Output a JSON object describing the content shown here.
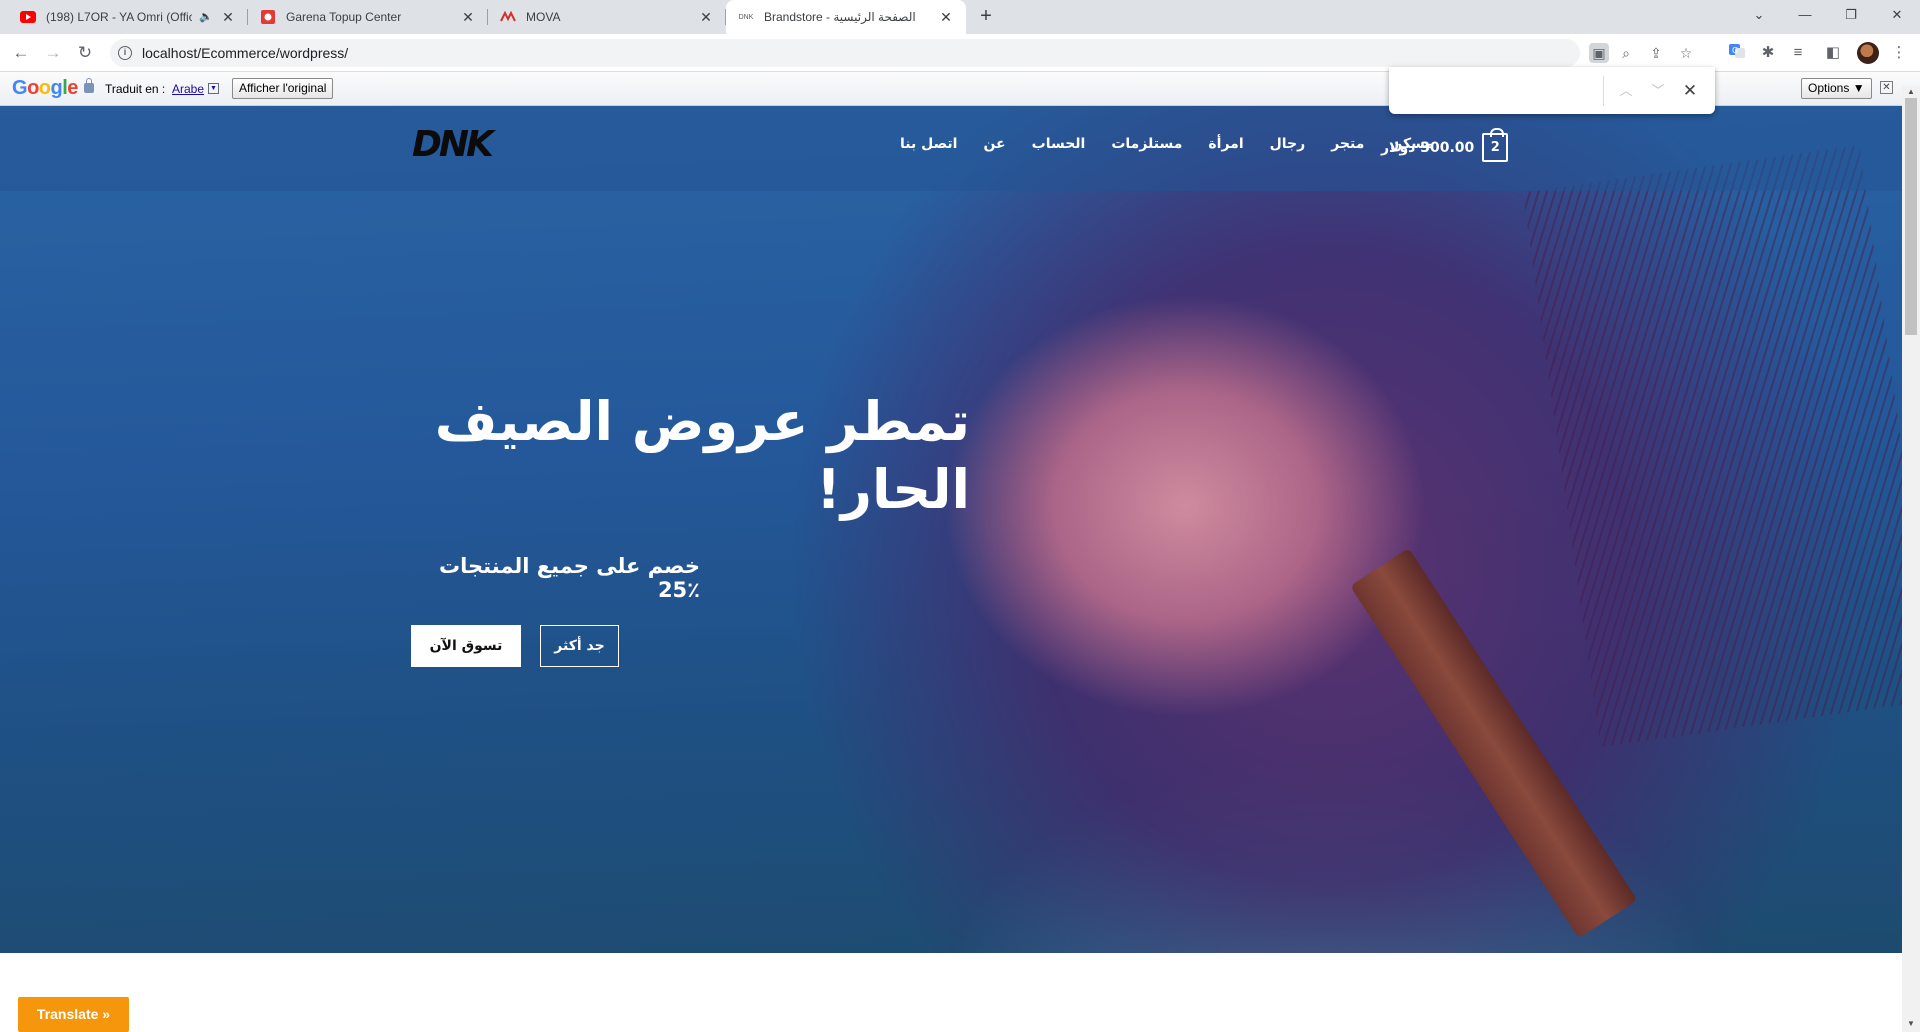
{
  "browser": {
    "tabs": [
      {
        "title": "(198) L7OR - YA Omri (Officia",
        "favicon": "youtube-icon",
        "audio": true
      },
      {
        "title": "Garena Topup Center",
        "favicon": "garena-icon"
      },
      {
        "title": "MOVA",
        "favicon": "mova-icon"
      },
      {
        "title": "Brandstore - الصفحة الرئيسية",
        "favicon": "brandstore-icon",
        "active": true
      }
    ],
    "new_tab": "+",
    "url": "localhost/Ecommerce/wordpress/"
  },
  "translate_bar": {
    "logo": "Google",
    "label": "Traduit en :",
    "language": "Arabe",
    "show_original": "Afficher l'original",
    "options": "Options ▼"
  },
  "site": {
    "logo": "DNK",
    "menu": [
      "مسكن",
      "متجر",
      "رجال",
      "امرأة",
      "مستلزمات",
      "الحساب",
      "عن",
      "اتصل بنا"
    ],
    "cart_amount": "300.00 دولار",
    "cart_count": "2"
  },
  "hero": {
    "headline": "تمطر عروض الصيف الحار!",
    "subline": "خصم على جميع المنتجات ٪25",
    "shop_button": "تسوق الآن",
    "more_button": "جد أكثر"
  },
  "translate_widget": "Translate »",
  "colors": {
    "hero_blue": "#2a64a4",
    "translate_orange": "#f5960c",
    "tabstrip": "#dee1e6"
  }
}
